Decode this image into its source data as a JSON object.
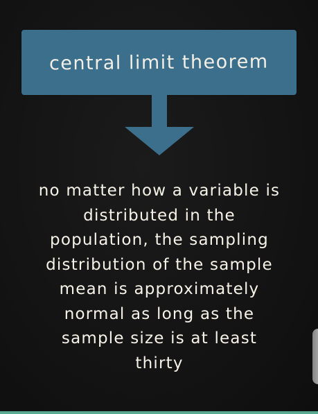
{
  "title": "central limit theorem",
  "colors": {
    "background": "#141414",
    "box": "#3b6f8c",
    "arrow": "#3b6f8c",
    "text": "#f6f2e8"
  },
  "arrow_icon": "down-arrow-icon",
  "statement_lines": [
    "no matter how a variable is",
    "distributed in the",
    "population, the sampling",
    "distribution of the sample",
    "mean is approximately",
    "normal as long as the",
    "sample size is at least",
    "thirty"
  ]
}
